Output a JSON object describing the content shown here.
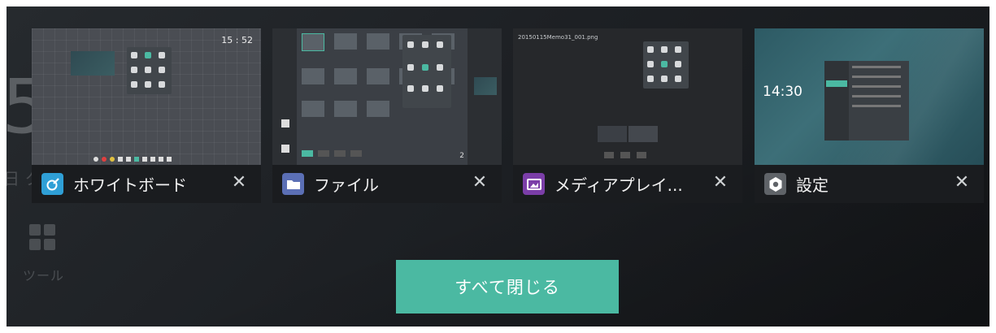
{
  "background": {
    "partial_number": "5",
    "partial_text": "日 ク",
    "tool_label": "ツール"
  },
  "apps": [
    {
      "title": "ホワイトボード",
      "icon": "whiteboard-icon",
      "icon_color": "#2f9fd6",
      "thumb_time": "15 : 52"
    },
    {
      "title": "ファイル",
      "icon": "folder-icon",
      "icon_color": "#5b6fb5",
      "thumb_filename": "",
      "thumb_bottom_num": "2"
    },
    {
      "title": "メディアプレイ...",
      "icon": "media-player-icon",
      "icon_color": "#7b3ea8",
      "thumb_filename": "20150115Memo31_001.png"
    },
    {
      "title": "設定",
      "icon": "gear-icon",
      "icon_color": "#5f6368",
      "thumb_time": "14:30"
    }
  ],
  "close_symbol": "✕",
  "close_all_label": "すべて閉じる",
  "colors": {
    "accent": "#4bb9a2",
    "bar": "#1a1c1f"
  }
}
